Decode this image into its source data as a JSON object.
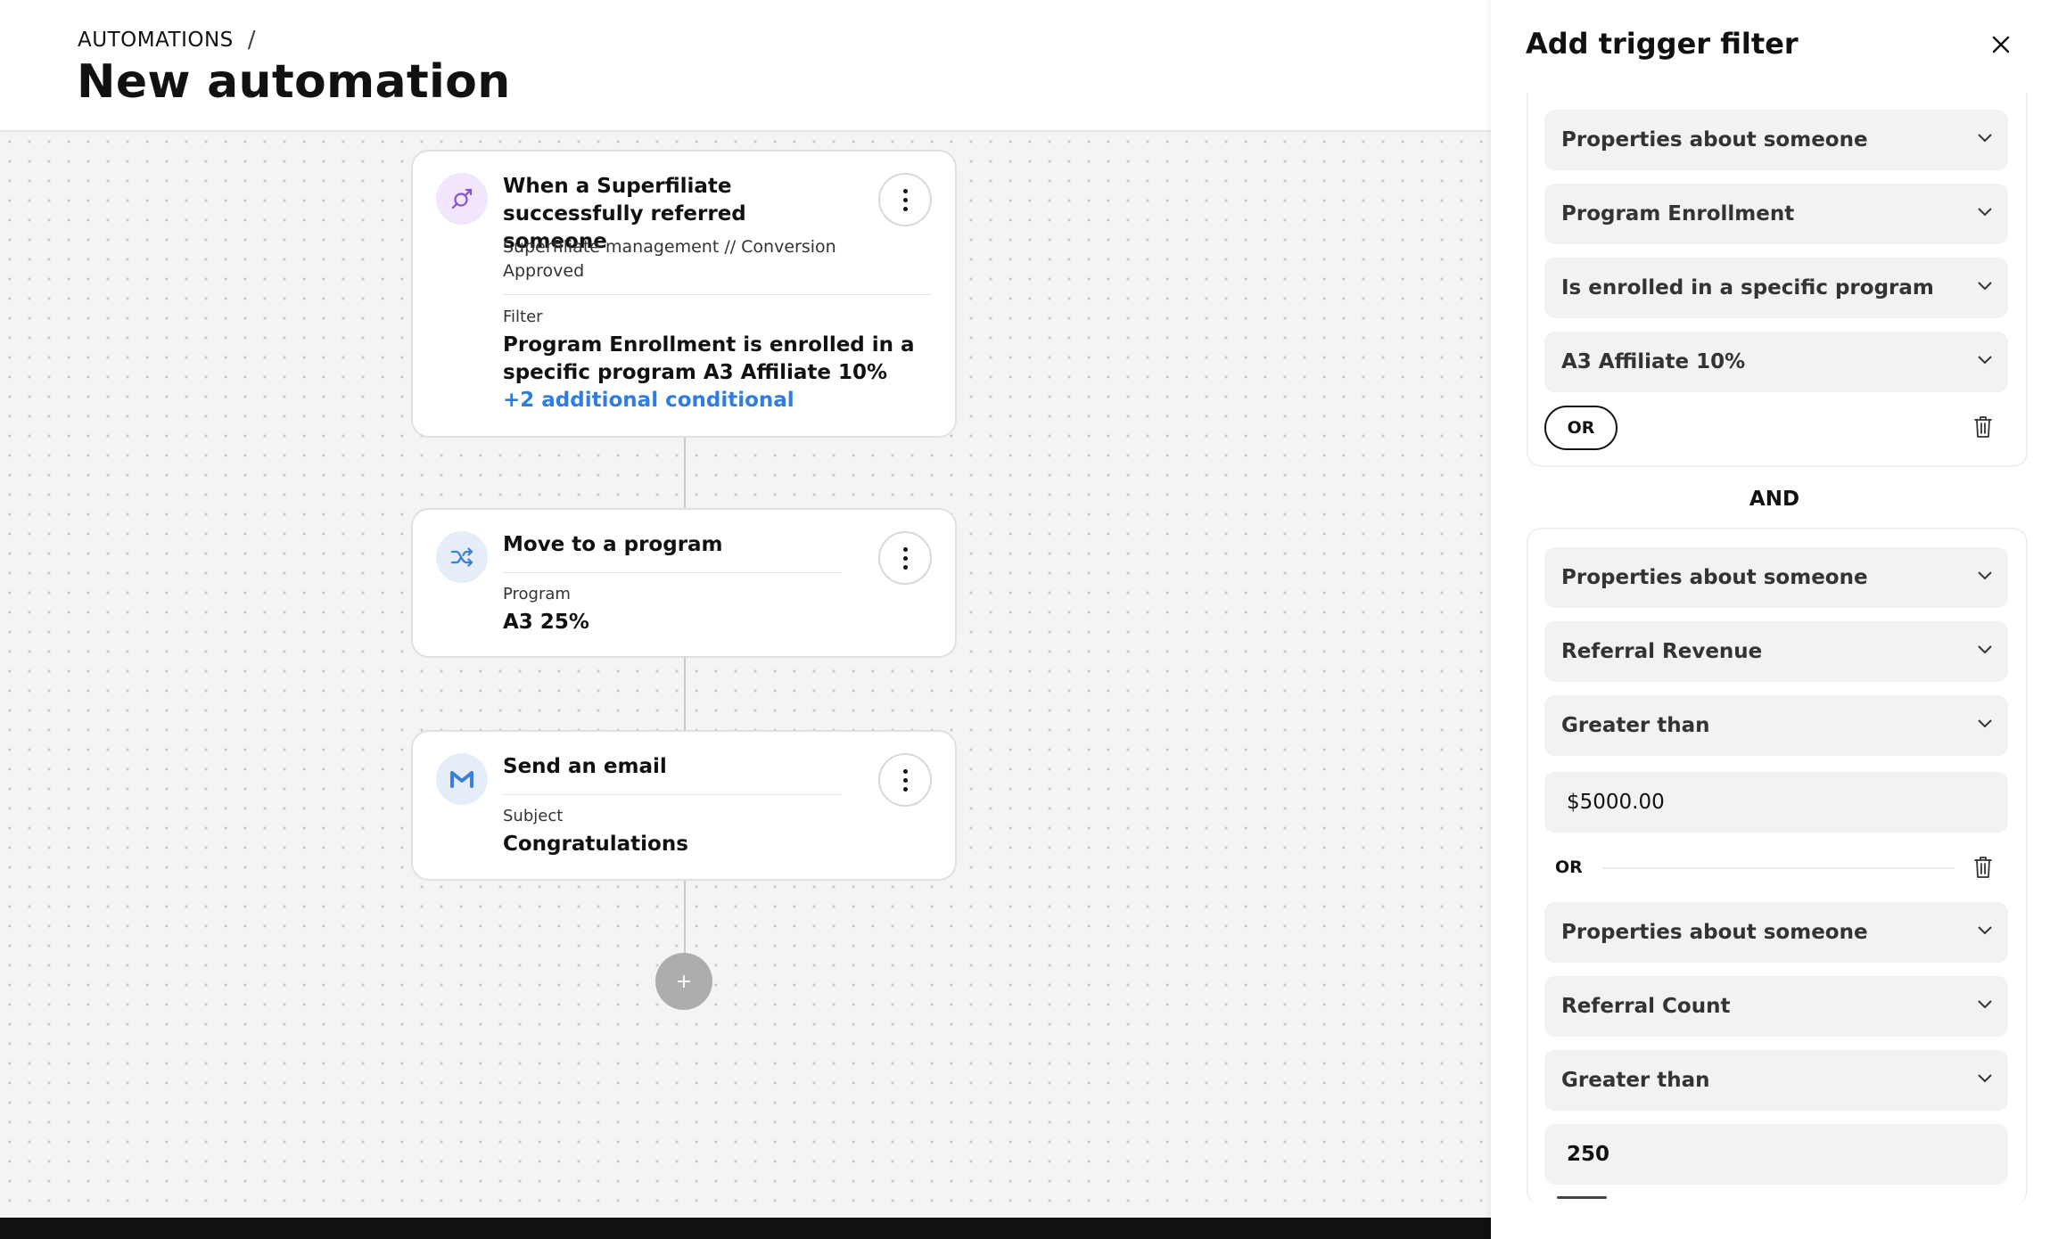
{
  "breadcrumb": {
    "parent": "AUTOMATIONS",
    "separator": "/"
  },
  "page_title": "New automation",
  "trigger_card": {
    "title": "When a Superfiliate successfully referred someone",
    "subtitle": "Superfiliate management // Conversion Approved",
    "filter_label": "Filter",
    "filter_value": "Program Enrollment is enrolled in a specific program A3 Affiliate 10%",
    "more_link": "+2 additional conditional"
  },
  "move_card": {
    "title": "Move to a program",
    "field_label": "Program",
    "field_value": "A3 25%"
  },
  "email_card": {
    "title": "Send an email",
    "field_label": "Subject",
    "field_value": "Congratulations"
  },
  "add_step": "+",
  "panel": {
    "title": "Add trigger filter",
    "group1": {
      "source": "Properties about someone",
      "property": "Program Enrollment",
      "operator": "Is enrolled in a specific program",
      "value": "A3 Affiliate 10%",
      "or_button": "OR"
    },
    "and_label": "AND",
    "group2": {
      "cond1": {
        "source": "Properties about someone",
        "property": "Referral Revenue",
        "operator": "Greater than",
        "value": "$5000.00"
      },
      "or_label": "OR",
      "cond2": {
        "source": "Properties about someone",
        "property": "Referral Count",
        "operator": "Greater than",
        "value": "250"
      }
    }
  },
  "colors": {
    "link": "#2f7de1",
    "trigger_icon_bg": "#f1e6fb",
    "action_icon_bg": "#e5edf8"
  }
}
